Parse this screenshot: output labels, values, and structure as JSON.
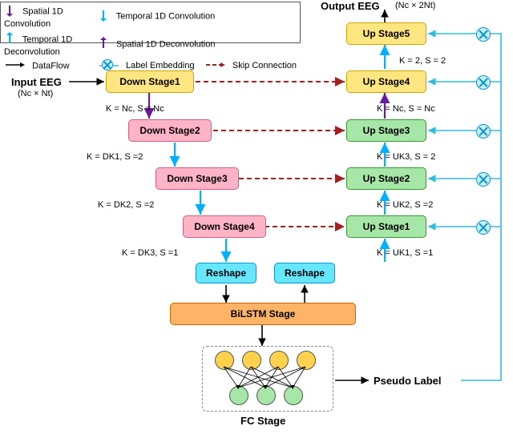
{
  "legend": {
    "spatial_conv": "Spatial 1D Convolution",
    "temporal_conv": "Temporal 1D Convolution",
    "temporal_deconv": "Temporal 1D Deconvolution",
    "spatial_deconv": "Spatial 1D Deconvolution",
    "dataflow": "DataFlow",
    "label_embed": "Label Embedding",
    "skip": "Skip Connection"
  },
  "io": {
    "input": "Input EEG",
    "input_dim": "(Nc × Nt)",
    "output": "Output EEG",
    "output_dim": "(Nc × 2Nt)"
  },
  "down": {
    "s1": "Down Stage1",
    "s2": "Down Stage2",
    "s3": "Down Stage3",
    "s4": "Down Stage4",
    "k1": "K = Nc, S = Nc",
    "k2": "K = DK1, S =2",
    "k3": "K = DK2, S =2",
    "k4": "K = DK3, S =1"
  },
  "up": {
    "s1": "Up Stage1",
    "s2": "Up Stage2",
    "s3": "Up Stage3",
    "s4": "Up Stage4",
    "s5": "Up Stage5",
    "k1": "K  = UK1, S =1",
    "k2": "K = UK2, S =2",
    "k3": "K = UK3, S = 2",
    "k4": "K = Nc, S = Nc",
    "k5": "K = 2, S = 2"
  },
  "mid": {
    "reshape_l": "Reshape",
    "reshape_r": "Reshape",
    "bilstm": "BiLSTM Stage",
    "fc": "FC Stage",
    "pseudo": "Pseudo Label"
  },
  "chart_data": {
    "type": "diagram",
    "left_path": [
      {
        "name": "Down Stage1",
        "op": "Spatial 1D Convolution",
        "params": "K=Nc, S=Nc"
      },
      {
        "name": "Down Stage2",
        "op": "Temporal 1D Convolution",
        "params": "K=DK1, S=2"
      },
      {
        "name": "Down Stage3",
        "op": "Temporal 1D Convolution",
        "params": "K=DK2, S=2"
      },
      {
        "name": "Down Stage4",
        "op": "Temporal 1D Convolution",
        "params": "K=DK3, S=1"
      },
      {
        "name": "Reshape"
      },
      {
        "name": "BiLSTM Stage"
      }
    ],
    "right_path": [
      {
        "name": "Reshape"
      },
      {
        "name": "Up Stage1",
        "op": "Temporal 1D Deconvolution",
        "params": "K=UK1, S=1"
      },
      {
        "name": "Up Stage2",
        "op": "Temporal 1D Deconvolution",
        "params": "K=UK2, S=2"
      },
      {
        "name": "Up Stage3",
        "op": "Temporal 1D Deconvolution",
        "params": "K=UK3, S=2"
      },
      {
        "name": "Up Stage4",
        "op": "Spatial 1D Deconvolution",
        "params": "K=Nc, S=Nc"
      },
      {
        "name": "Up Stage5",
        "op": "",
        "params": "K=2, S=2"
      }
    ],
    "skip_connections": [
      [
        "Down Stage1",
        "Up Stage4"
      ],
      [
        "Down Stage2",
        "Up Stage3"
      ],
      [
        "Down Stage3",
        "Up Stage2"
      ],
      [
        "Down Stage4",
        "Up Stage1"
      ]
    ],
    "label_embedding_targets": [
      "Up Stage1",
      "Up Stage2",
      "Up Stage3",
      "Up Stage4",
      "Up Stage5"
    ],
    "classifier": "FC Stage -> Pseudo Label",
    "input": "Input EEG (Nc × Nt)",
    "output": "Output EEG (Nc × 2Nt)"
  }
}
